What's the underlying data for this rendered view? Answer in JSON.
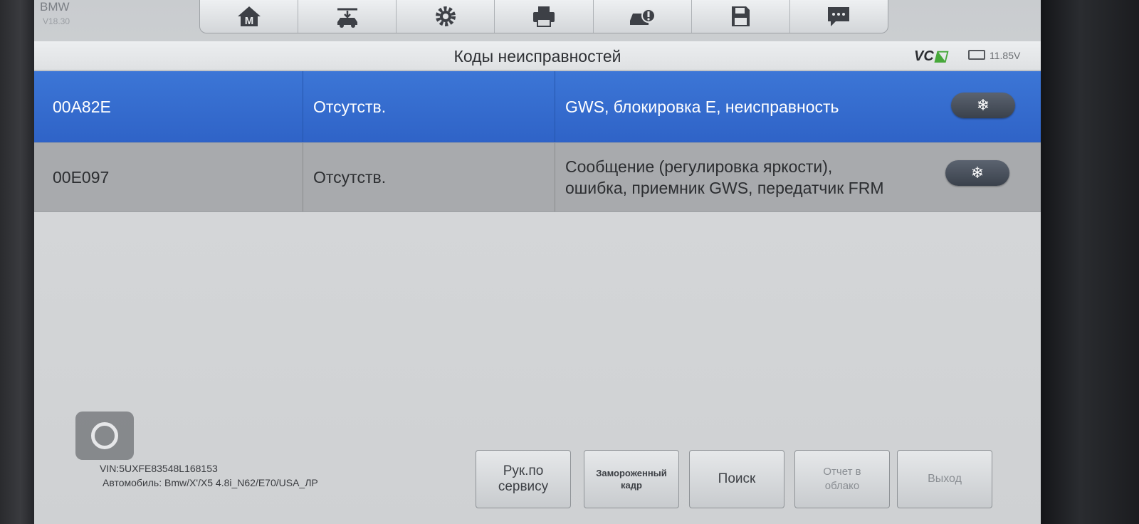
{
  "brand": {
    "name": "BMW",
    "version": "V18.30"
  },
  "toolbar": {
    "items": [
      {
        "icon": "home-m-icon"
      },
      {
        "icon": "car-lift-icon"
      },
      {
        "icon": "gear-icon"
      },
      {
        "icon": "printer-icon"
      },
      {
        "icon": "car-settings-icon"
      },
      {
        "icon": "save-icon"
      },
      {
        "icon": "chat-icon"
      }
    ]
  },
  "header": {
    "title": "Коды неисправностей",
    "vci": "VC",
    "voltage": "11.85V"
  },
  "dtc_rows": [
    {
      "code": "00A82E",
      "status": "Отсутств.",
      "desc_line1": "GWS, блокировка E, неисправность",
      "desc_line2": "",
      "freeze_icon": "snowflake-icon",
      "selected": true
    },
    {
      "code": "00E097",
      "status": "Отсутств.",
      "desc_line1": "Сообщение (регулировка яркости),",
      "desc_line2": "ошибка, приемник GWS, передатчик FRM",
      "freeze_icon": "snowflake-icon",
      "selected": false
    }
  ],
  "vehicle": {
    "vin": "VIN:5UXFE83548L168153",
    "car": "Автомобиль: Bmw/X'/X5 4.8i_N62/E70/USA_ЛР"
  },
  "buttons": {
    "service_line1": "Рук.по",
    "service_line2": "сервису",
    "freeze_line1": "Замороженный",
    "freeze_line2": "кадр",
    "search": "Поиск",
    "report_line1": "Отчет в",
    "report_line2": "облако",
    "exit": "Выход"
  },
  "colors": {
    "selected_row": "#3c76d6",
    "row": "#a8aaad",
    "vci_accent": "#47a83a"
  }
}
